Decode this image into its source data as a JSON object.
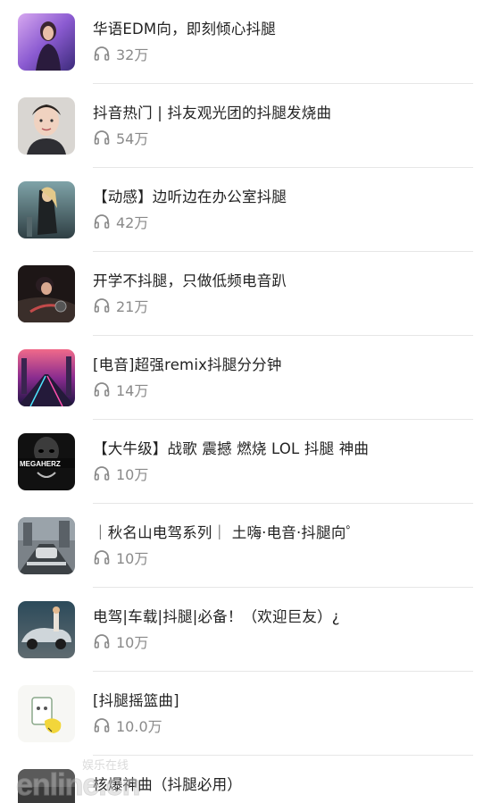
{
  "colors": {
    "title_text": "#222222",
    "meta_text": "#8a8a8a",
    "divider": "#e6e6e6",
    "background": "#ffffff"
  },
  "playlist": {
    "items": [
      {
        "title": "华语EDM向，即刻倾心抖腿",
        "plays": "32万",
        "icon": "headphones-icon"
      },
      {
        "title": "抖音热门 | 抖友观光团的抖腿发烧曲",
        "plays": "54万",
        "icon": "headphones-icon"
      },
      {
        "title": "【动感】边听边在办公室抖腿",
        "plays": "42万",
        "icon": "headphones-icon"
      },
      {
        "title": "开学不抖腿，只做低频电音趴",
        "plays": "21万",
        "icon": "headphones-icon"
      },
      {
        "title": "[电音]超强remix抖腿分分钟",
        "plays": "14万",
        "icon": "headphones-icon"
      },
      {
        "title": "【大牛级】战歌 震撼 燃烧 LOL 抖腿 神曲",
        "plays": "10万",
        "icon": "headphones-icon"
      },
      {
        "title": "｜秋名山电驾系列｜ 土嗨·电音·抖腿向゜",
        "plays": "10万",
        "icon": "headphones-icon"
      },
      {
        "title": "电驾|车载|抖腿|必备！（欢迎巨友）¿",
        "plays": "10万",
        "icon": "headphones-icon"
      },
      {
        "title": "[抖腿摇篮曲]",
        "plays": "10.0万",
        "icon": "headphones-icon"
      },
      {
        "title": "核爆神曲（抖腿必用）",
        "plays": "",
        "icon": "headphones-icon"
      }
    ]
  },
  "thumb_text": {
    "item6": "MEGAHERZ"
  },
  "watermark": {
    "big": "enline.cn",
    "small": "娱乐在线"
  }
}
